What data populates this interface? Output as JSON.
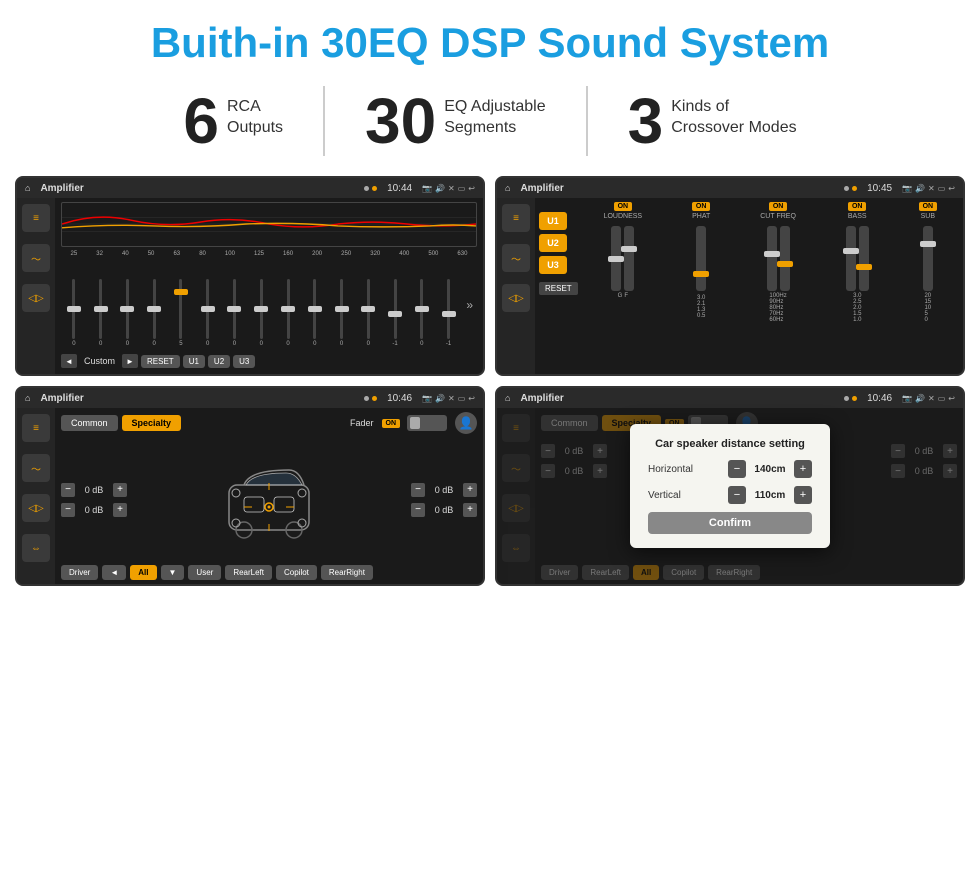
{
  "header": {
    "title": "Buith-in 30EQ DSP Sound System"
  },
  "stats": [
    {
      "number": "6",
      "line1": "RCA",
      "line2": "Outputs"
    },
    {
      "number": "30",
      "line1": "EQ Adjustable",
      "line2": "Segments"
    },
    {
      "number": "3",
      "line1": "Kinds of",
      "line2": "Crossover Modes"
    }
  ],
  "screens": [
    {
      "id": "screen1",
      "status_bar": {
        "title": "Amplifier",
        "time": "10:44"
      },
      "label": "EQ Screen"
    },
    {
      "id": "screen2",
      "status_bar": {
        "title": "Amplifier",
        "time": "10:45"
      },
      "label": "EQ Presets Screen"
    },
    {
      "id": "screen3",
      "status_bar": {
        "title": "Amplifier",
        "time": "10:46"
      },
      "label": "Fader Screen"
    },
    {
      "id": "screen4",
      "status_bar": {
        "title": "Amplifier",
        "time": "10:46"
      },
      "label": "Speaker Distance Screen",
      "dialog": {
        "title": "Car speaker distance setting",
        "horizontal_label": "Horizontal",
        "horizontal_value": "140cm",
        "vertical_label": "Vertical",
        "vertical_value": "110cm",
        "confirm_label": "Confirm"
      }
    }
  ],
  "eq_screen": {
    "frequencies": [
      "25",
      "32",
      "40",
      "50",
      "63",
      "80",
      "100",
      "125",
      "160",
      "200",
      "250",
      "320",
      "400",
      "500",
      "630"
    ],
    "values": [
      "0",
      "0",
      "0",
      "0",
      "5",
      "0",
      "0",
      "0",
      "0",
      "0",
      "0",
      "0",
      "-1",
      "0",
      "-1"
    ],
    "bottom_labels": [
      "Custom",
      "RESET",
      "U1",
      "U2",
      "U3"
    ]
  },
  "amp2_screen": {
    "presets": [
      "U1",
      "U2",
      "U3"
    ],
    "controls": [
      {
        "label": "LOUDNESS",
        "on": true
      },
      {
        "label": "PHAT",
        "on": true
      },
      {
        "label": "CUT FREQ",
        "on": true
      },
      {
        "label": "BASS",
        "on": true
      },
      {
        "label": "SUB",
        "on": true
      }
    ],
    "reset_label": "RESET"
  },
  "fader_screen": {
    "tabs": [
      {
        "label": "Common",
        "active": false
      },
      {
        "label": "Specialty",
        "active": true
      }
    ],
    "fader_label": "Fader",
    "on_label": "ON",
    "db_values": [
      {
        "val": "0 dB"
      },
      {
        "val": "0 dB"
      },
      {
        "val": "0 dB"
      },
      {
        "val": "0 dB"
      }
    ],
    "bottom_buttons": [
      "Driver",
      "RearLeft",
      "All",
      "User",
      "RearRight",
      "Copilot"
    ]
  },
  "dialog": {
    "title": "Car speaker distance setting",
    "horizontal_label": "Horizontal",
    "horizontal_value": "140cm",
    "vertical_label": "Vertical",
    "vertical_value": "110cm",
    "confirm_label": "Confirm",
    "db_right_top": "0 dB",
    "db_right_bottom": "0 dB"
  },
  "buttons": {
    "common_label": "Common",
    "specialty_label": "Specialty",
    "driver_label": "Driver",
    "copilot_label": "Copilot",
    "rearleft_label": "RearLeft",
    "rearright_label": "RearRight",
    "all_label": "All",
    "user_label": "User",
    "reset_label": "RESET",
    "on_label": "ON"
  }
}
